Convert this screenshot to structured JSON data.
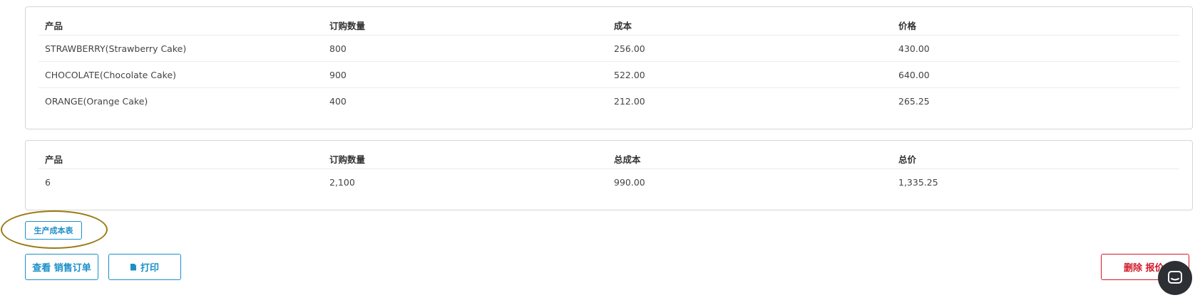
{
  "items_table": {
    "headers": [
      "产品",
      "订购数量",
      "成本",
      "价格"
    ],
    "rows": [
      [
        "STRAWBERRY(Strawberry Cake)",
        "800",
        "256.00",
        "430.00"
      ],
      [
        "CHOCOLATE(Chocolate Cake)",
        "900",
        "522.00",
        "640.00"
      ],
      [
        "ORANGE(Orange Cake)",
        "400",
        "212.00",
        "265.25"
      ]
    ]
  },
  "totals_table": {
    "headers": [
      "产品",
      "订购数量",
      "总成本",
      "总价"
    ],
    "rows": [
      [
        "6",
        "2,100",
        "990.00",
        "1,335.25"
      ]
    ]
  },
  "buttons": {
    "production_cost_sheet": "生产成本表",
    "view_sales_order": "查看 销售订单",
    "print": "打印",
    "delete_quote": "删除 报价"
  },
  "icons": {
    "print": "document-icon",
    "chat": "chat-icon"
  },
  "colors": {
    "accent": "#1b8fc9",
    "danger": "#d11a2a",
    "highlight": "#9a7a14",
    "chat_bg": "#2c2f33"
  }
}
